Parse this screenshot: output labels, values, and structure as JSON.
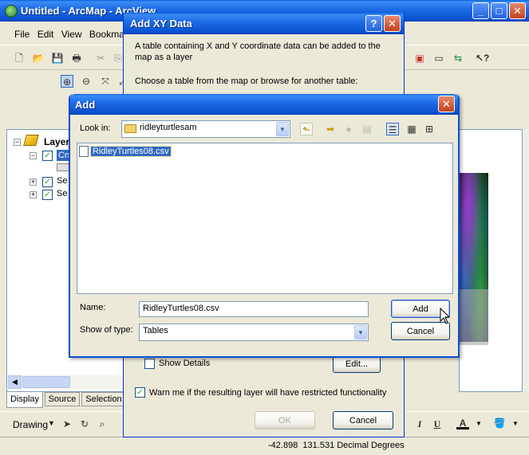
{
  "arcmap": {
    "title": "Untitled - ArcMap - ArcView",
    "menu": [
      "File",
      "Edit",
      "View",
      "Bookmarks"
    ],
    "toc_title": "Layers",
    "layer_items": [
      "Cn",
      "Se",
      "Se"
    ],
    "tabs": [
      "Display",
      "Source",
      "Selection"
    ],
    "drawing_label": "Drawing",
    "status_coords": "-42.898  131.531 Decimal Degrees"
  },
  "xy_dialog": {
    "title": "Add XY Data",
    "intro": "A table containing X and Y coordinate data can be added to the map as a layer",
    "choose": "Choose a table from the map or browse for another table:",
    "show_details": "Show Details",
    "edit_button": "Edit...",
    "warn_label": "Warn me if the resulting layer will have restricted functionality",
    "ok_button": "OK",
    "cancel_button": "Cancel"
  },
  "add_dialog": {
    "title": "Add",
    "look_in_label": "Look in:",
    "look_in_value": "ridleyturtlesam",
    "files": [
      "RidleyTurtles08.csv"
    ],
    "name_label": "Name:",
    "name_value": "RidleyTurtles08.csv",
    "type_label": "Show of type:",
    "type_value": "Tables",
    "add_button": "Add",
    "cancel_button": "Cancel"
  },
  "colors": {
    "titlebar": "#0b52d1",
    "selection": "#316ac5",
    "window_bg": "#ece9d8"
  }
}
